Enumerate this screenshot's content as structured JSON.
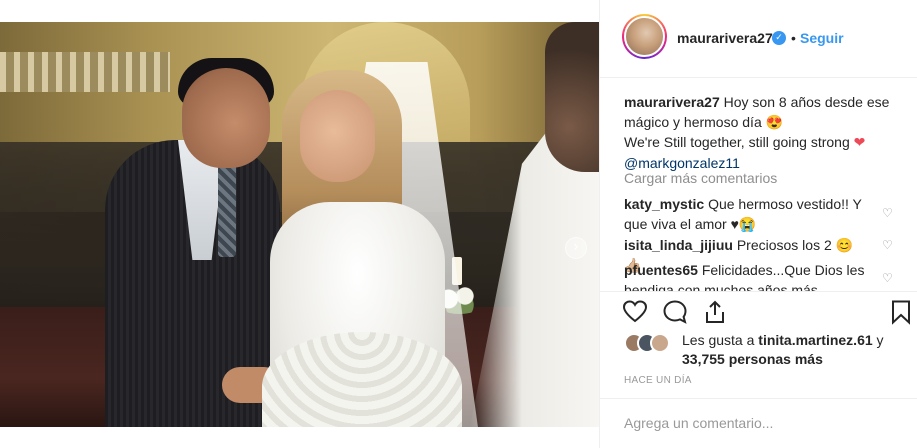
{
  "post": {
    "image_alt": "",
    "next_icon": "chevron-right-icon"
  },
  "header": {
    "username": "maurarivera27",
    "verified_icon": "check-icon",
    "separator": "•",
    "follow_label": "Seguir"
  },
  "caption": {
    "username": "maurarivera27",
    "line1": "Hoy son 8 años desde ese mágico y hermoso día 😍",
    "line2": "We're Still together, still going strong",
    "heart": "❤",
    "mention": "@markgonzalez11"
  },
  "load_more": "Cargar más comentarios",
  "comments": [
    {
      "username": "katy_mystic",
      "text": "Que hermoso vestido!! Y que viva el amor ♥😭"
    },
    {
      "username": "isita_linda_jijiuu",
      "text": "Preciosos los 2 😊👍🏼"
    },
    {
      "username": "pfuentes65",
      "text": "Felicidades...Que Dios les bendiga con muchos años más"
    }
  ],
  "actions": {
    "like_icon": "heart-icon",
    "comment_icon": "comment-icon",
    "share_icon": "share-icon",
    "save_icon": "bookmark-icon"
  },
  "likes": {
    "prefix": "Les gusta a",
    "user": "tinita.martinez.61",
    "connector": "y",
    "count": "33,755 personas más"
  },
  "timestamp": "HACE UN DÍA",
  "add_comment_placeholder": "Agrega un comentario...",
  "colors": {
    "link": "#3897f0",
    "mention": "#003569",
    "muted": "#8e8e8e",
    "heart": "#ed4956",
    "text": "#262626"
  }
}
